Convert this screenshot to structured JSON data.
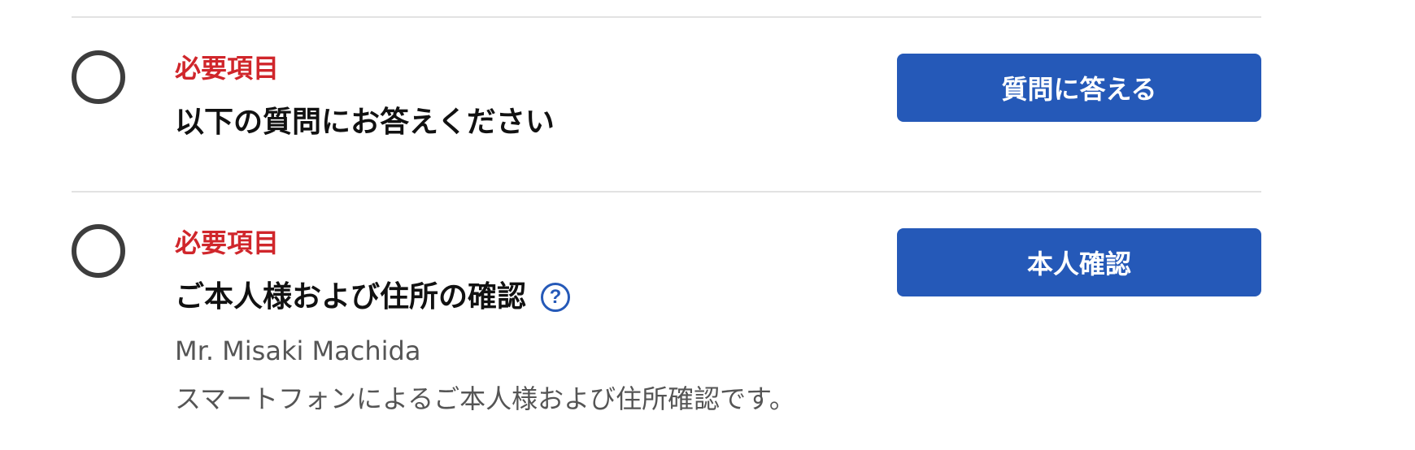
{
  "items": [
    {
      "required_label": "必要項目",
      "title": "以下の質問にお答えください",
      "button_label": "質問に答える"
    },
    {
      "required_label": "必要項目",
      "title": "ご本人様および住所の確認",
      "help_icon_glyph": "?",
      "name": "Mr. Misaki Machida",
      "description": "スマートフォンによるご本人様および住所確認です。",
      "button_label": "本人確認"
    }
  ],
  "colors": {
    "required": "#d0262b",
    "button": "#2559b8",
    "circle": "#3d3d3d"
  }
}
